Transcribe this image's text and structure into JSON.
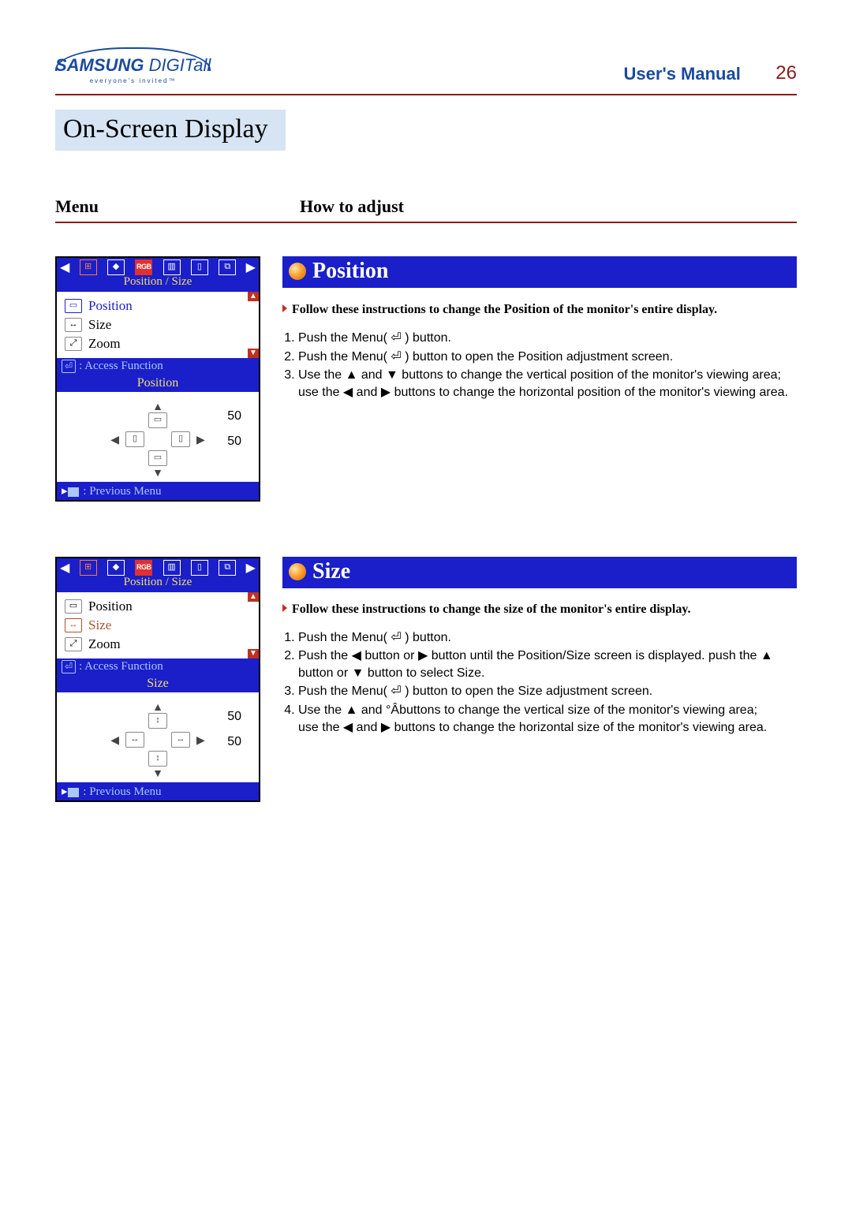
{
  "header": {
    "brand_main": "SAMSUNG",
    "brand_sub": "DIGITall",
    "brand_tagline": "everyone's invited™",
    "manual_title": "User's Manual",
    "page_number": "26"
  },
  "section_title": "On-Screen Display",
  "columns": {
    "left": "Menu",
    "right": "How to adjust"
  },
  "osd_common": {
    "tab_label": "Position / Size",
    "access_label": ": Access Function",
    "prev_label": ": Previous Menu",
    "list": {
      "position": "Position",
      "size": "Size",
      "zoom": "Zoom"
    },
    "value_h": "50",
    "value_v": "50"
  },
  "position": {
    "title": "Position",
    "panel_title": "Position",
    "lead_pre": "Follow these instructions to change the ",
    "lead_bold": "Position",
    "lead_post": " of the monitor's entire display.",
    "steps": [
      "Push the Menu( ⏎ ) button.",
      "Push the Menu( ⏎ ) button to open the Position adjustment screen.",
      "Use the ▲ and ▼ buttons to change the vertical position of the monitor's viewing area; use the ◀ and ▶ buttons to change the horizontal position of the monitor's viewing area."
    ]
  },
  "size": {
    "title": "Size",
    "panel_title": "Size",
    "lead": "Follow these instructions to change the size of the monitor's entire display.",
    "steps": [
      "Push the Menu( ⏎ ) button.",
      "Push the ◀ button or ▶ button until the Position/Size screen is displayed. push the ▲ button or ▼ button to select Size.",
      "Push the Menu( ⏎ ) button to open the Size adjustment screen.",
      "Use the ▲ and °Âbuttons to change the vertical size of the monitor's viewing area;\nuse the ◀ and ▶ buttons to change the horizontal size of the monitor's viewing area."
    ]
  }
}
